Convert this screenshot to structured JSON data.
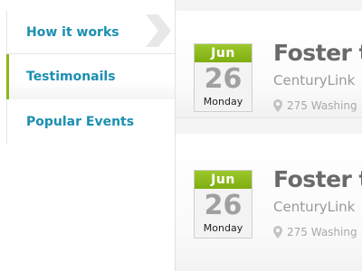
{
  "sidebar": {
    "items": [
      {
        "label": "How it works"
      },
      {
        "label": "Testimonails"
      },
      {
        "label": "Popular Events"
      }
    ]
  },
  "events": [
    {
      "month": "Jun",
      "day": "26",
      "weekday": "Monday",
      "title": "Foster t",
      "organization": "CenturyLink",
      "address": "275 Washing"
    },
    {
      "month": "Jun",
      "day": "26",
      "weekday": "Monday",
      "title": "Foster t",
      "organization": "CenturyLink",
      "address": "275 Washing"
    }
  ],
  "colors": {
    "accent_green": "#8ab81a",
    "link_blue": "#1b8fb1",
    "title_gray": "#6a6a6a"
  },
  "icons": {
    "nav_arrow": "chevron-right-icon",
    "location": "map-pin-icon"
  }
}
